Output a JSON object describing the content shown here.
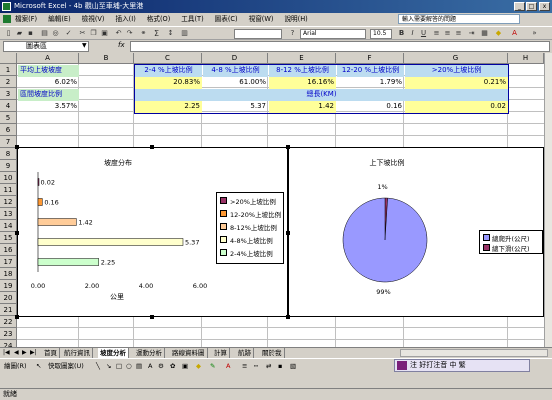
{
  "window": {
    "title": "Microsoft Excel - 4b 觀山至車埔-大里港",
    "minimize": "_",
    "restore": "□",
    "close": "x"
  },
  "menu": {
    "items": [
      "檔案(F)",
      "編輯(E)",
      "檢視(V)",
      "插入(I)",
      "格式(O)",
      "工具(T)",
      "圖表(C)",
      "視窗(W)",
      "說明(H)"
    ],
    "help_placeholder": "輸入需要解答的問題"
  },
  "toolbar": {
    "sum_symbol": "Σ",
    "zoom": "",
    "font_name": "Arial",
    "font_size": "10.5",
    "bold": "B",
    "italic": "I",
    "underline": "U"
  },
  "formula_bar": {
    "name_box": "圖表區",
    "fx": "fx",
    "formula": ""
  },
  "columns": [
    "A",
    "B",
    "C",
    "D",
    "E",
    "F",
    "G",
    "H"
  ],
  "rows": [
    "1",
    "2",
    "3",
    "4",
    "5",
    "6",
    "7",
    "8",
    "9",
    "10",
    "11",
    "12",
    "13",
    "14",
    "15",
    "16",
    "17",
    "18",
    "19",
    "20",
    "21",
    "22",
    "23",
    "24"
  ],
  "cells": {
    "a1": "平均上坡坡度",
    "a2": "6.02%",
    "a3": "區間坡度比例",
    "a4": "3.57%",
    "c1": "2-4 %上坡比例",
    "d1": "4-8 %上坡比例",
    "e1": "8-12 %上坡比例",
    "f1": "12-20 %上坡比例",
    "g1": ">20%上坡比例",
    "c2": "20.83%",
    "d2": "61.00%",
    "e2": "16.16%",
    "f2": "1.79%",
    "g2": "0.21%",
    "c3": "總長(KM)",
    "c4": "2.25",
    "d4": "5.37",
    "e4": "1.42",
    "f4": "0.16",
    "g4": "0.02"
  },
  "chart_data": [
    {
      "type": "bar",
      "title": "坡度分布",
      "xlabel": "公里",
      "ylabel": "",
      "orientation": "horizontal",
      "categories": [
        ">20%上坡比例",
        "12-20%上坡比例",
        "8-12%上坡比例",
        "4-8%上坡比例",
        "2-4%上坡比例"
      ],
      "values": [
        0.02,
        0.16,
        1.42,
        5.37,
        2.25
      ],
      "data_labels": [
        "0.02",
        "0.16",
        "1.42",
        "5.37",
        "2.25"
      ],
      "colors": [
        "#993366",
        "#ff9933",
        "#ffcc99",
        "#ffffcc",
        "#ccffcc"
      ],
      "xlim": [
        0,
        6
      ],
      "xticks": [
        "0.00",
        "2.00",
        "4.00",
        "6.00"
      ],
      "legend_position": "right",
      "legend": [
        ">20%上坡比例",
        "12-20%上坡比例",
        "8-12%上坡比例",
        "4-8%上坡比例",
        "2-4%上坡比例"
      ]
    },
    {
      "type": "pie",
      "title": "上下坡比例",
      "labels": [
        "總爬升(公尺)",
        "總下滑(公尺)"
      ],
      "values": [
        99,
        1
      ],
      "data_labels": [
        "99%",
        "1%"
      ],
      "colors": [
        "#9999ff",
        "#993366"
      ],
      "legend_position": "right"
    }
  ],
  "sheet_tabs": [
    "首頁",
    "航行資訊",
    "坡度分析",
    "運動分析",
    "路線資料圖",
    "計算",
    "航跡",
    "關於我"
  ],
  "active_tab": "坡度分析",
  "draw_toolbar": {
    "draw_label": "繪圖(R)",
    "autoshape_label": "快取圖案(U)"
  },
  "ime": {
    "text": "注 好打注音 中 繁"
  },
  "status": {
    "text": "就緒"
  },
  "colors": {
    "label_fill": "#c8eec8",
    "header_fill": "#bcdcf0",
    "value_fill": "#ffff99",
    "label_text": "#0000c8"
  }
}
